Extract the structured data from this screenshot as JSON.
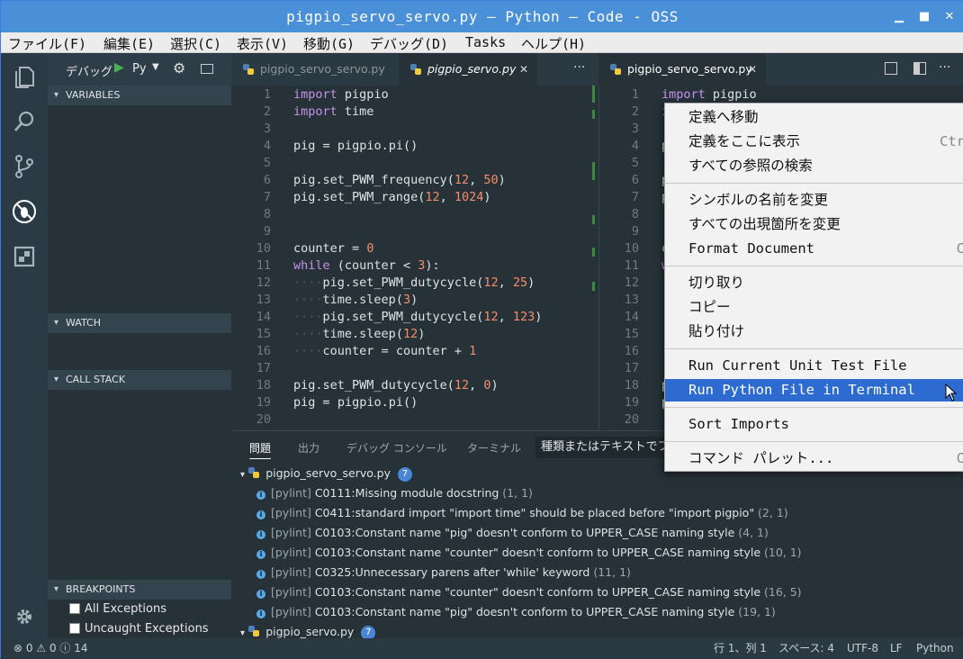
{
  "window": {
    "title": "pigpio_servo_servo.py — Python — Code - OSS"
  },
  "menubar": [
    "ファイル(F)",
    "編集(E)",
    "選択(C)",
    "表示(V)",
    "移動(G)",
    "デバッグ(D)",
    "Tasks",
    "ヘルプ(H)"
  ],
  "debug_toolbar": {
    "label": "デバッグ",
    "config": "Py"
  },
  "sidebar": {
    "variables": "VARIABLES",
    "watch": "WATCH",
    "call_stack": "CALL STACK",
    "breakpoints": "BREAKPOINTS",
    "breakpoint_items": [
      "All Exceptions",
      "Uncaught Exceptions"
    ]
  },
  "tabs": {
    "left": [
      "pigpio_servo_servo.py",
      "pigpio_servo.py"
    ],
    "right": [
      "pigpio_servo_servo.py"
    ]
  },
  "editor": {
    "line_numbers": [
      "1",
      "2",
      "3",
      "4",
      "5",
      "6",
      "7",
      "8",
      "9",
      "10",
      "11",
      "12",
      "13",
      "14",
      "15",
      "16",
      "17",
      "18",
      "19",
      "20"
    ],
    "lines": [
      "import pigpio",
      "import time",
      "",
      "pig = pigpio.pi()",
      "",
      "pig.set_PWM_frequency(12, 50)",
      "pig.set_PWM_range(12, 1024)",
      "",
      "",
      "counter = 0",
      "while (counter < 3):",
      "    pig.set_PWM_dutycycle(12, 25)",
      "    time.sleep(3)",
      "    pig.set_PWM_dutycycle(12, 123)",
      "    time.sleep(12)",
      "    counter = counter + 1",
      "",
      "pig.set_PWM_dutycycle(12, 0)",
      "pig = pigpio.pi()",
      ""
    ]
  },
  "panel": {
    "tabs": [
      "問題",
      "出力",
      "デバッグ コンソール",
      "ターミナル"
    ],
    "filter_placeholder": "種類またはテキストでフィルター",
    "files": [
      {
        "name": "pigpio_servo_servo.py",
        "count": "7"
      },
      {
        "name": "pigpio_servo.py",
        "count": "7"
      }
    ],
    "problems": [
      {
        "source": "[pylint]",
        "message": "C0111:Missing module docstring",
        "loc": "(1, 1)"
      },
      {
        "source": "[pylint]",
        "message": "C0411:standard import \"import time\" should be placed before \"import pigpio\"",
        "loc": "(2, 1)"
      },
      {
        "source": "[pylint]",
        "message": "C0103:Constant name \"pig\" doesn't conform to UPPER_CASE naming style",
        "loc": "(4, 1)"
      },
      {
        "source": "[pylint]",
        "message": "C0103:Constant name \"counter\" doesn't conform to UPPER_CASE naming style",
        "loc": "(10, 1)"
      },
      {
        "source": "[pylint]",
        "message": "C0325:Unnecessary parens after 'while' keyword",
        "loc": "(11, 1)"
      },
      {
        "source": "[pylint]",
        "message": "C0103:Constant name \"counter\" doesn't conform to UPPER_CASE naming style",
        "loc": "(16, 5)"
      },
      {
        "source": "[pylint]",
        "message": "C0103:Constant name \"pig\" doesn't conform to UPPER_CASE naming style",
        "loc": "(19, 1)"
      }
    ]
  },
  "status": {
    "errors": "0",
    "warnings": "0",
    "infos": "14",
    "position": "行 1、列 1",
    "spaces": "スペース: 4",
    "encoding": "UTF-8",
    "eol": "LF",
    "language": "Python"
  },
  "context_menu": {
    "items": [
      {
        "label": "定義へ移動",
        "shortcut": ""
      },
      {
        "label": "定義をここに表示",
        "shortcut": "Ctr"
      },
      {
        "label": "すべての参照の検索",
        "shortcut": ""
      },
      {
        "label": "シンボルの名前を変更",
        "shortcut": ""
      },
      {
        "label": "すべての出現箇所を変更",
        "shortcut": ""
      },
      {
        "label": "Format Document",
        "shortcut": "C"
      },
      {
        "label": "切り取り",
        "shortcut": ""
      },
      {
        "label": "コピー",
        "shortcut": ""
      },
      {
        "label": "貼り付け",
        "shortcut": ""
      },
      {
        "label": "Run Current Unit Test File",
        "shortcut": ""
      },
      {
        "label": "Run Python File in Terminal",
        "shortcut": ""
      },
      {
        "label": "Sort Imports",
        "shortcut": ""
      },
      {
        "label": "コマンド パレット...",
        "shortcut": "C"
      }
    ],
    "highlighted": "Run Python File in Terminal"
  },
  "colors": {
    "accent": "#2d6bd1",
    "titlebar": "#4a90d9",
    "editor_bg": "#263238",
    "keyword": "#c792ea",
    "number": "#f78c6c"
  }
}
